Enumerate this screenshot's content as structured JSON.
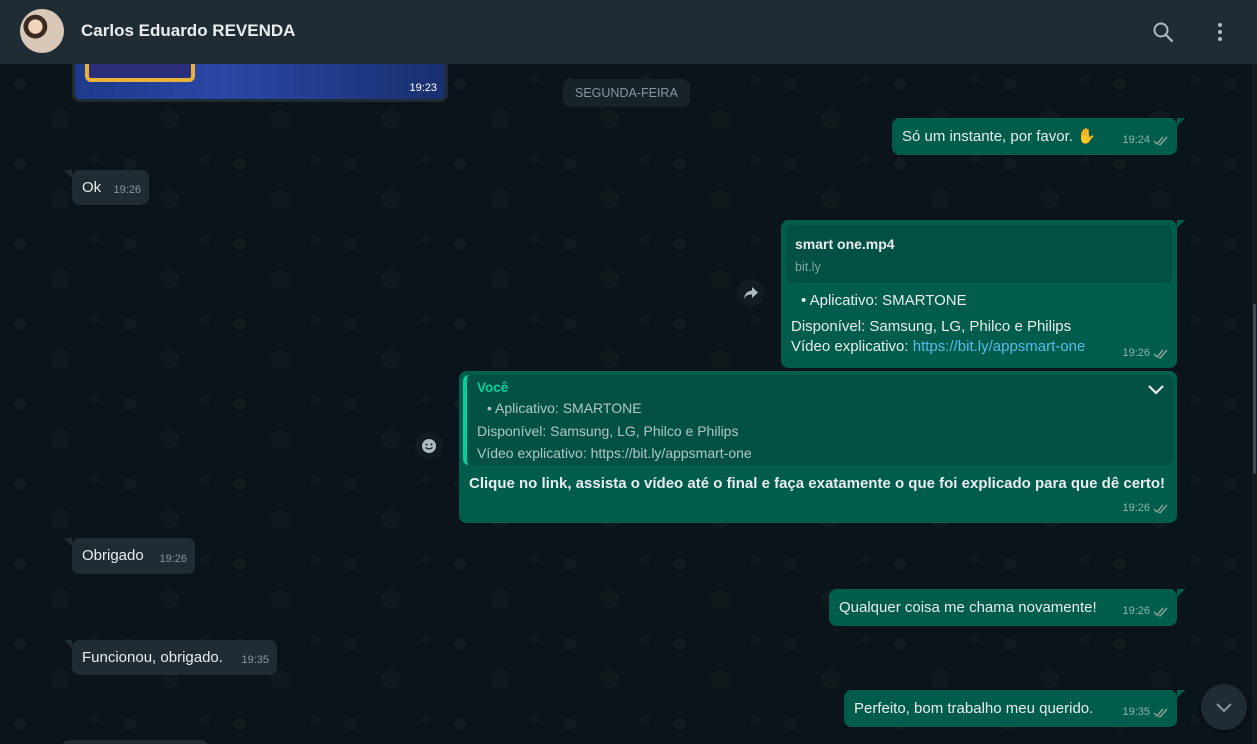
{
  "header": {
    "contact_name": "Carlos Eduardo REVENDA",
    "icons": [
      "search-icon",
      "menu-dots-icon"
    ]
  },
  "date_divider": "SEGUNDA-FEIRA",
  "messages": [
    {
      "direction": "in",
      "type": "image",
      "time": "19:23"
    },
    {
      "direction": "out",
      "text": "Só um instante, por favor. ✋",
      "time": "19:24",
      "status": "read"
    },
    {
      "direction": "in",
      "text": "Ok",
      "time": "19:26"
    },
    {
      "direction": "out",
      "type": "link",
      "card_title": "smart one.mp4",
      "card_domain": "bit.ly",
      "line1": "• Aplicativo: SMARTONE",
      "line2": "Disponível: Samsung, LG, Philco e Philips",
      "line3_label": "Vídeo explicativo: ",
      "line3_link": "https://bit.ly/appsmart-one",
      "time": "19:26",
      "status": "read"
    },
    {
      "direction": "out",
      "type": "reply",
      "quote_author": "Você",
      "quote_line1": "• Aplicativo: SMARTONE",
      "quote_line2": "Disponível: Samsung, LG, Philco e Philips",
      "quote_line3": "Vídeo explicativo: https://bit.ly/appsmart-one",
      "text": "Clique no link, assista o vídeo até o final e faça exatamente o que foi explicado para que dê certo!",
      "time": "19:26",
      "status": "read"
    },
    {
      "direction": "in",
      "text": "Obrigado",
      "time": "19:26"
    },
    {
      "direction": "out",
      "text": "Qualquer coisa me chama novamente!",
      "time": "19:26",
      "status": "read"
    },
    {
      "direction": "in",
      "text": "Funcionou, obrigado.",
      "time": "19:35"
    },
    {
      "direction": "out",
      "text": "Perfeito, bom trabalho meu querido.",
      "time": "19:35",
      "status": "read"
    }
  ],
  "colors": {
    "header_bg": "#202c33",
    "chat_bg": "#0b141a",
    "incoming_bubble": "#202c33",
    "outgoing_bubble": "#005c4b",
    "accent": "#06cf9c",
    "link": "#53bdeb"
  }
}
